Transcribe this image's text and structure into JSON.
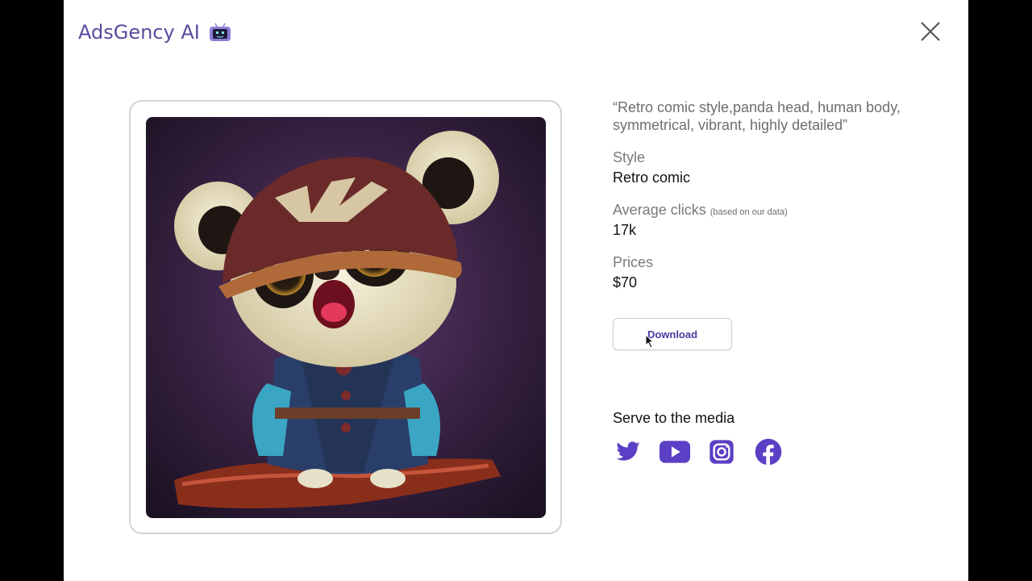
{
  "app": {
    "brand_name": "AdsGency AI",
    "brand_icon": "robot-icon",
    "accent_color": "#5b4a9e"
  },
  "dialog": {
    "close_icon": "close-icon"
  },
  "image": {
    "description": "panda-pirate-artwork"
  },
  "details": {
    "prompt": "“Retro comic style,panda head, human body, symmetrical, vibrant, highly detailed”",
    "style_label": "Style",
    "style_value": "Retro comic",
    "clicks_label": "Average clicks",
    "clicks_note": "(based on our data)",
    "clicks_value": "17k",
    "prices_label": "Prices",
    "prices_value": "$70",
    "download_label": "Download"
  },
  "serve": {
    "title": "Serve to the media",
    "icons": [
      "twitter-icon",
      "youtube-icon",
      "instagram-icon",
      "facebook-icon"
    ],
    "icon_color": "#5b3fc4"
  }
}
